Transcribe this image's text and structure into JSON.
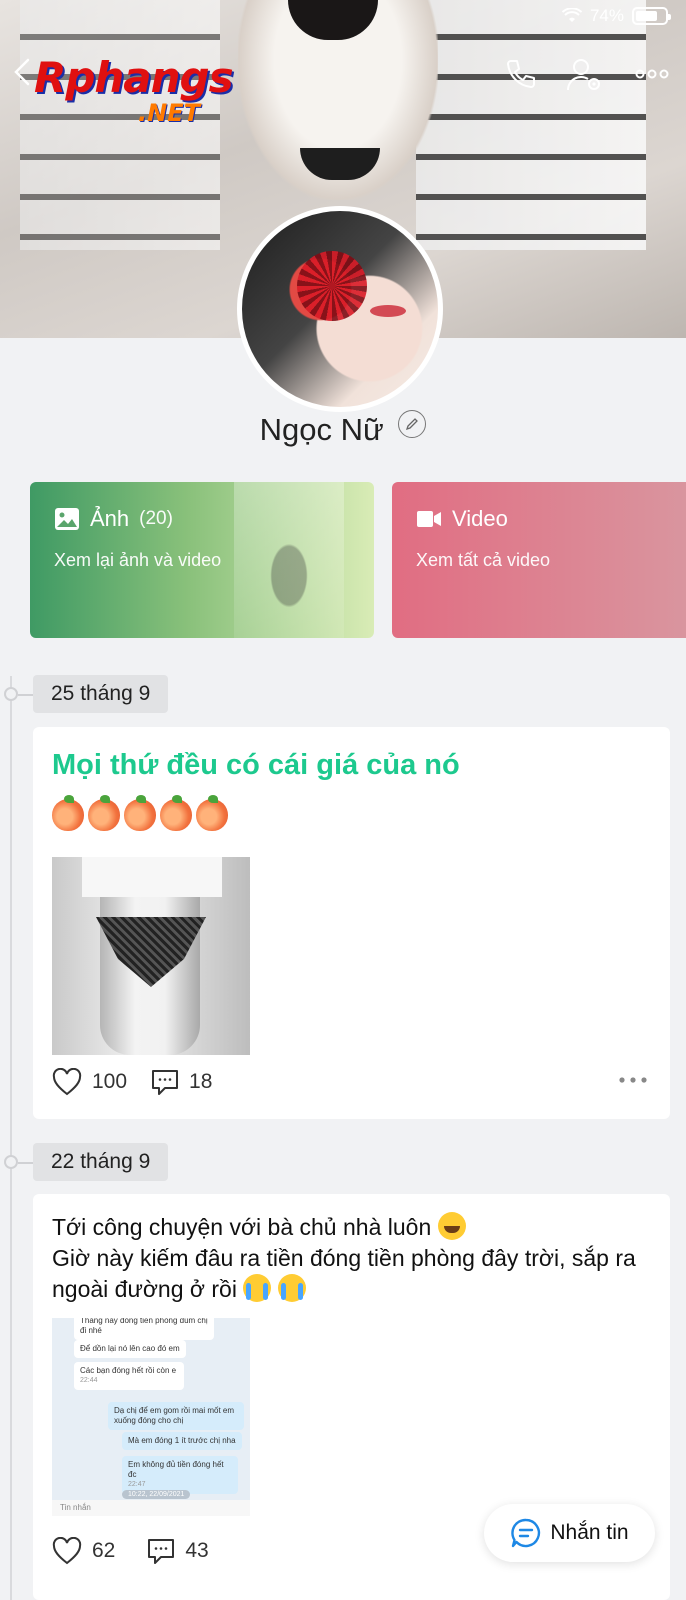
{
  "status_bar": {
    "battery_text": "74%",
    "battery_level": 0.74
  },
  "watermark": {
    "line1": "Rphangs",
    "line2": ".NET"
  },
  "header_icons": [
    "back-icon",
    "phone-icon",
    "user-settings-icon",
    "more-icon"
  ],
  "profile": {
    "name": "Ngọc Nữ"
  },
  "media_cards": [
    {
      "title": "Ảnh",
      "count": "(20)",
      "subtitle": "Xem lại ảnh và video",
      "icon": "image-icon",
      "color": "#3f9a64"
    },
    {
      "title": "Video",
      "subtitle": "Xem tất cả video",
      "icon": "video-icon",
      "color": "#e16d82"
    }
  ],
  "posts": [
    {
      "date": "25 tháng 9",
      "title": "Mọi thứ đều có cái giá của nó",
      "title_color": "#1dc98e",
      "emojis": [
        "peach",
        "peach",
        "peach",
        "peach",
        "peach"
      ],
      "likes": "100",
      "comments": "18"
    },
    {
      "date": "22 tháng 9",
      "text_line1": "Tới công chuyện với bà chủ nhà luôn",
      "text_line2": "Giờ này kiếm đâu ra tiền đóng tiền phòng đây trời, sắp ra ngoài đường ở rồi",
      "chat": {
        "m1": "Tháng này đóng tiền phòng dùm chị đi nhé",
        "m2": "Để dồn lại nó lên cao đó em",
        "m3": "Các bạn đóng hết rồi còn e",
        "m3_time": "22:44",
        "m4": "Dạ chị để em gom rồi mai mốt em xuống đóng cho chị",
        "m5": "Mà em đóng 1 ít trước chị nha",
        "m6": "Em không đủ tiền đóng hết đc",
        "m6_time": "22:47",
        "stamp": "10:22, 22/09/2021",
        "footer": "Tin nhắn"
      },
      "likes": "62",
      "comments": "43"
    }
  ],
  "fab": {
    "label": "Nhắn tin"
  }
}
